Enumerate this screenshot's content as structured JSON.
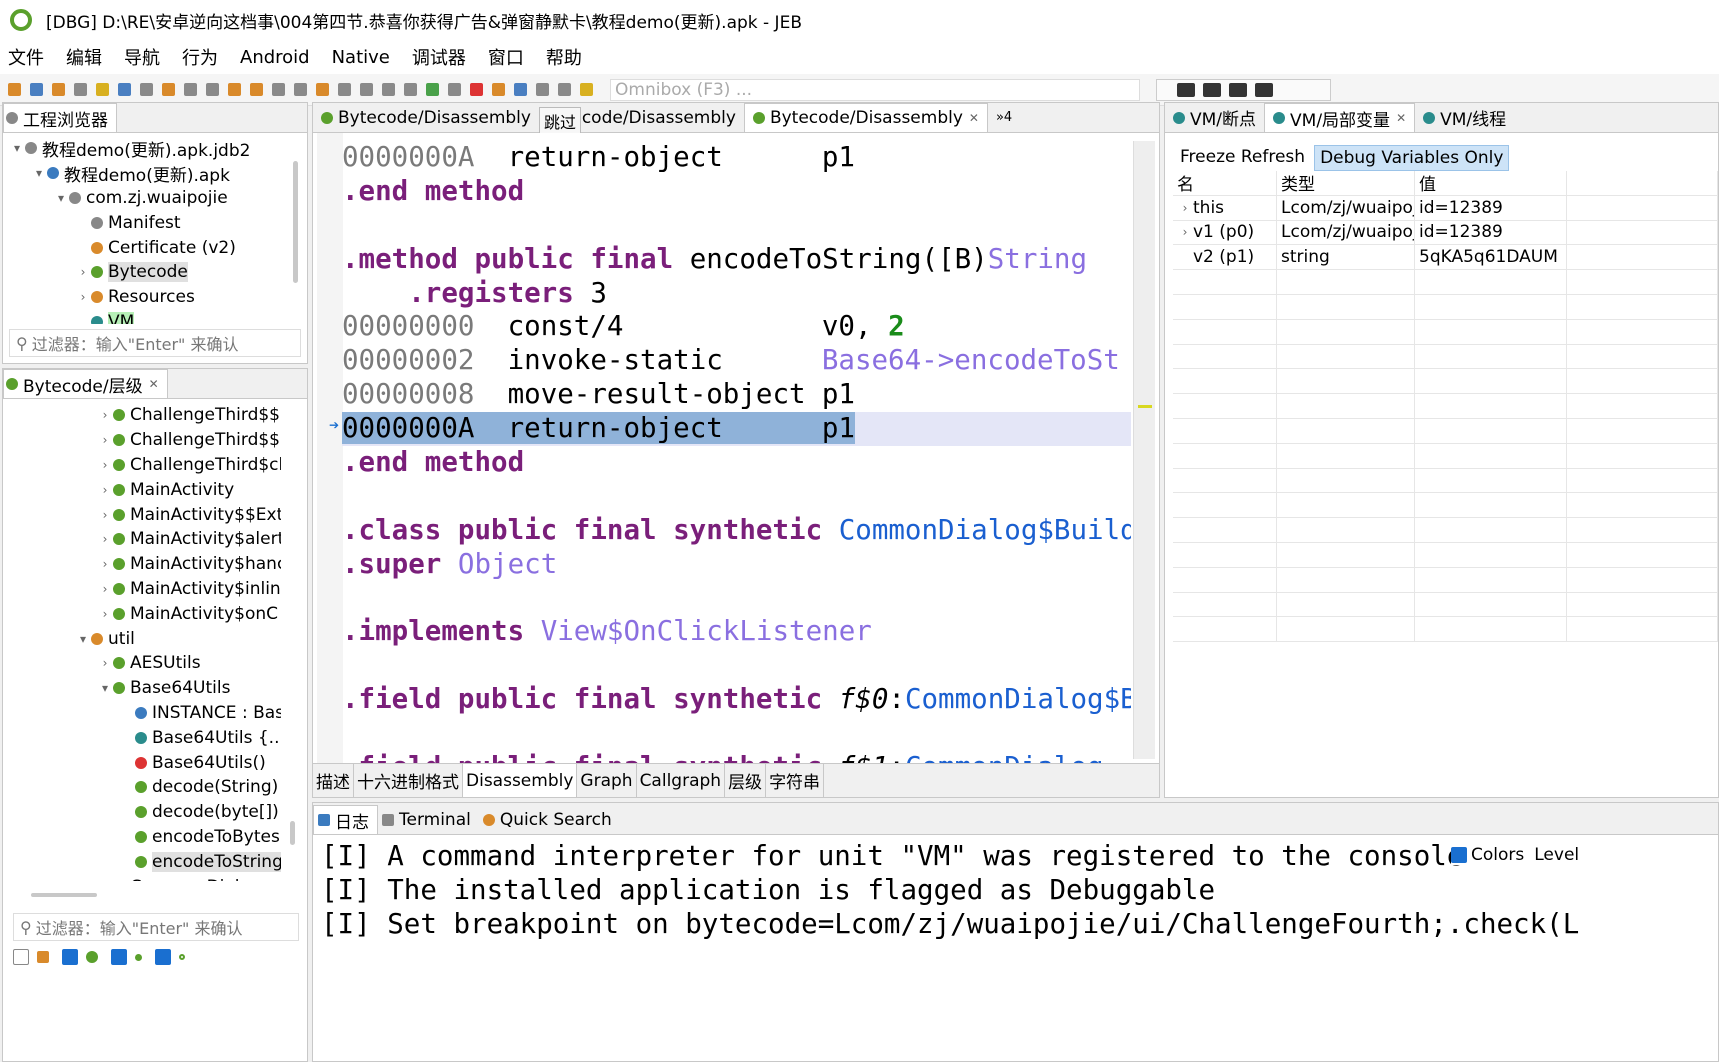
{
  "window": {
    "title": "[DBG] D:\\RE\\安卓逆向这档事\\004第四节.恭喜你获得广告&弹窗静默卡\\教程demo(更新).apk - JEB"
  },
  "menu": [
    "文件",
    "编辑",
    "导航",
    "行为",
    "Android",
    "Native",
    "调试器",
    "窗口",
    "帮助"
  ],
  "omnibox": {
    "placeholder": "Omnibox (F3) ..."
  },
  "project": {
    "tab": "工程浏览器",
    "items": [
      {
        "label": "教程demo(更新).apk.jdb2"
      },
      {
        "label": "教程demo(更新).apk"
      },
      {
        "label": "com.zj.wuaipojie"
      },
      {
        "label": "Manifest"
      },
      {
        "label": "Certificate (v2)"
      },
      {
        "label": "Bytecode"
      },
      {
        "label": "Resources"
      },
      {
        "label": "VM"
      }
    ],
    "filter_placeholder": "过滤器：输入\"Enter\" 来确认"
  },
  "hierarchy": {
    "tab": "Bytecode/层级",
    "items": [
      {
        "label": "ChallengeThird$$"
      },
      {
        "label": "ChallengeThird$$"
      },
      {
        "label": "ChallengeThird$cl"
      },
      {
        "label": "MainActivity"
      },
      {
        "label": "MainActivity$$Ext"
      },
      {
        "label": "MainActivity$alert"
      },
      {
        "label": "MainActivity$hanc"
      },
      {
        "label": "MainActivity$inlin"
      },
      {
        "label": "MainActivity$onC"
      },
      {
        "label": "util"
      },
      {
        "label": "AESUtils"
      },
      {
        "label": "Base64Utils"
      },
      {
        "label": "INSTANCE : Bas"
      },
      {
        "label": "Base64Utils {...}"
      },
      {
        "label": "Base64Utils()"
      },
      {
        "label": "decode(String)"
      },
      {
        "label": "decode(byte[])"
      },
      {
        "label": "encodeToBytes"
      },
      {
        "label": "encodeToString"
      },
      {
        "label": "CommonDialog"
      }
    ],
    "filter_placeholder": "过滤器：输入\"Enter\" 来确认"
  },
  "editor": {
    "tabs": [
      "Bytecode/Disassembly",
      "Bytecode/Disassembly",
      "Bytecode/Disassembly"
    ],
    "tooltip": "跳过",
    "overflow": "»4",
    "lines": [
      {
        "a": "0000000A",
        "op": "return-object",
        "arg": "p1"
      },
      {
        "kw": ".end method"
      },
      {},
      {
        "kw": ".method public final ",
        "name": "encodeToString([B)",
        "ret": "String"
      },
      {
        "kw": "    .registers ",
        "n": "3"
      },
      {
        "a": "00000000",
        "op": "const/4",
        "arg": "v0, ",
        "num": "2"
      },
      {
        "a": "00000002",
        "op": "invoke-static",
        "cls": "Base64->encodeToSt"
      },
      {
        "a": "00000008",
        "op": "move-result-object",
        "arg": "p1"
      },
      {
        "a": "0000000A",
        "op": "return-object",
        "arg": "p1",
        "hl": true
      },
      {
        "kw": ".end method"
      },
      {},
      {
        "kw": ".class public final synthetic ",
        "ty": "CommonDialog$Build"
      },
      {
        "kw": ".super ",
        "cls": "Object"
      },
      {},
      {
        "kw": ".implements ",
        "cls": "View$OnClickListener"
      },
      {},
      {
        "kw": ".field public final synthetic ",
        "f": "f$0",
        ":": ":",
        "ty": "CommonDialog$B"
      },
      {},
      {
        "kw": ".field public final synthetic ",
        "f": "f$1",
        ":": ":",
        "ty": "CommonDialog"
      }
    ],
    "bottom_tabs": [
      "描述",
      "十六进制格式",
      "Disassembly",
      "Graph",
      "Callgraph",
      "层级",
      "字符串"
    ]
  },
  "vm": {
    "tabs": [
      "VM/断点",
      "VM/局部变量",
      "VM/线程"
    ],
    "freeze": "Freeze Refresh",
    "debug_only": "Debug Variables Only",
    "columns": [
      "名",
      "类型",
      "值",
      ""
    ],
    "rows": [
      {
        "name": "this",
        "type": "Lcom/zj/wuaipoj",
        "value": "id=12389"
      },
      {
        "name": "v1 (p0)",
        "type": "Lcom/zj/wuaipoj",
        "value": "id=12389"
      },
      {
        "name": "v2 (p1)",
        "type": "string",
        "value": "5qKA5q61DAUM"
      }
    ]
  },
  "console": {
    "tabs": [
      "日志",
      "Terminal",
      "Quick Search"
    ],
    "colors_label": "Colors",
    "level_label": "Level",
    "lines": [
      "[I] A command interpreter for unit \"VM\" was registered to the console",
      "[I] The installed application is flagged as Debuggable",
      "[I] Set breakpoint on bytecode=Lcom/zj/wuaipojie/ui/ChallengeFourth;.check(L"
    ]
  }
}
